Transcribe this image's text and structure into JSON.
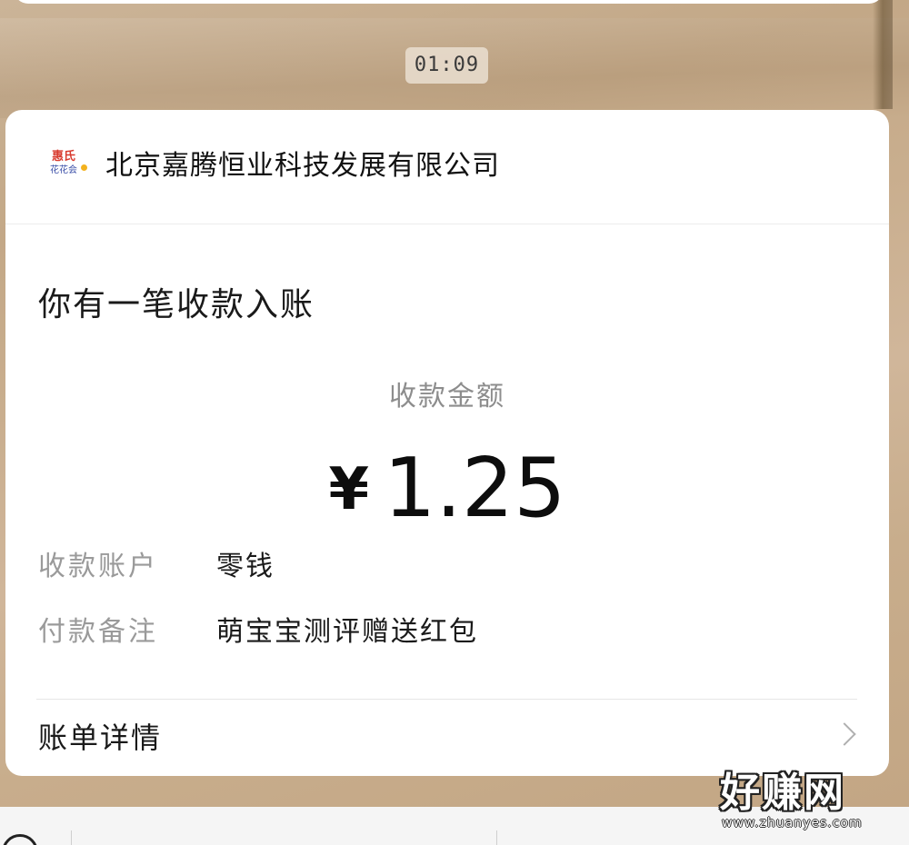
{
  "chat": {
    "timestamp": "01:09"
  },
  "message_card": {
    "sender": {
      "logo_top": "惠氏",
      "logo_bottom": "花花会",
      "name": "北京嘉腾恒业科技发展有限公司"
    },
    "notice_title": "你有一笔收款入账",
    "amount_label": "收款金额",
    "currency_symbol": "¥",
    "amount": "1.25",
    "rows": [
      {
        "label": "收款账户",
        "value": "零钱"
      },
      {
        "label": "付款备注",
        "value": "萌宝宝测评赠送红包"
      }
    ],
    "detail_link": "账单详情"
  },
  "watermark": {
    "main": "好赚网",
    "sub": "www.zhuanyes.com"
  },
  "colors": {
    "card_bg": "#ffffff",
    "label_gray": "#9a9a9a",
    "text_dark": "#1a1a1a",
    "logo_red": "#d83a2e",
    "logo_blue": "#3b4fa8"
  }
}
